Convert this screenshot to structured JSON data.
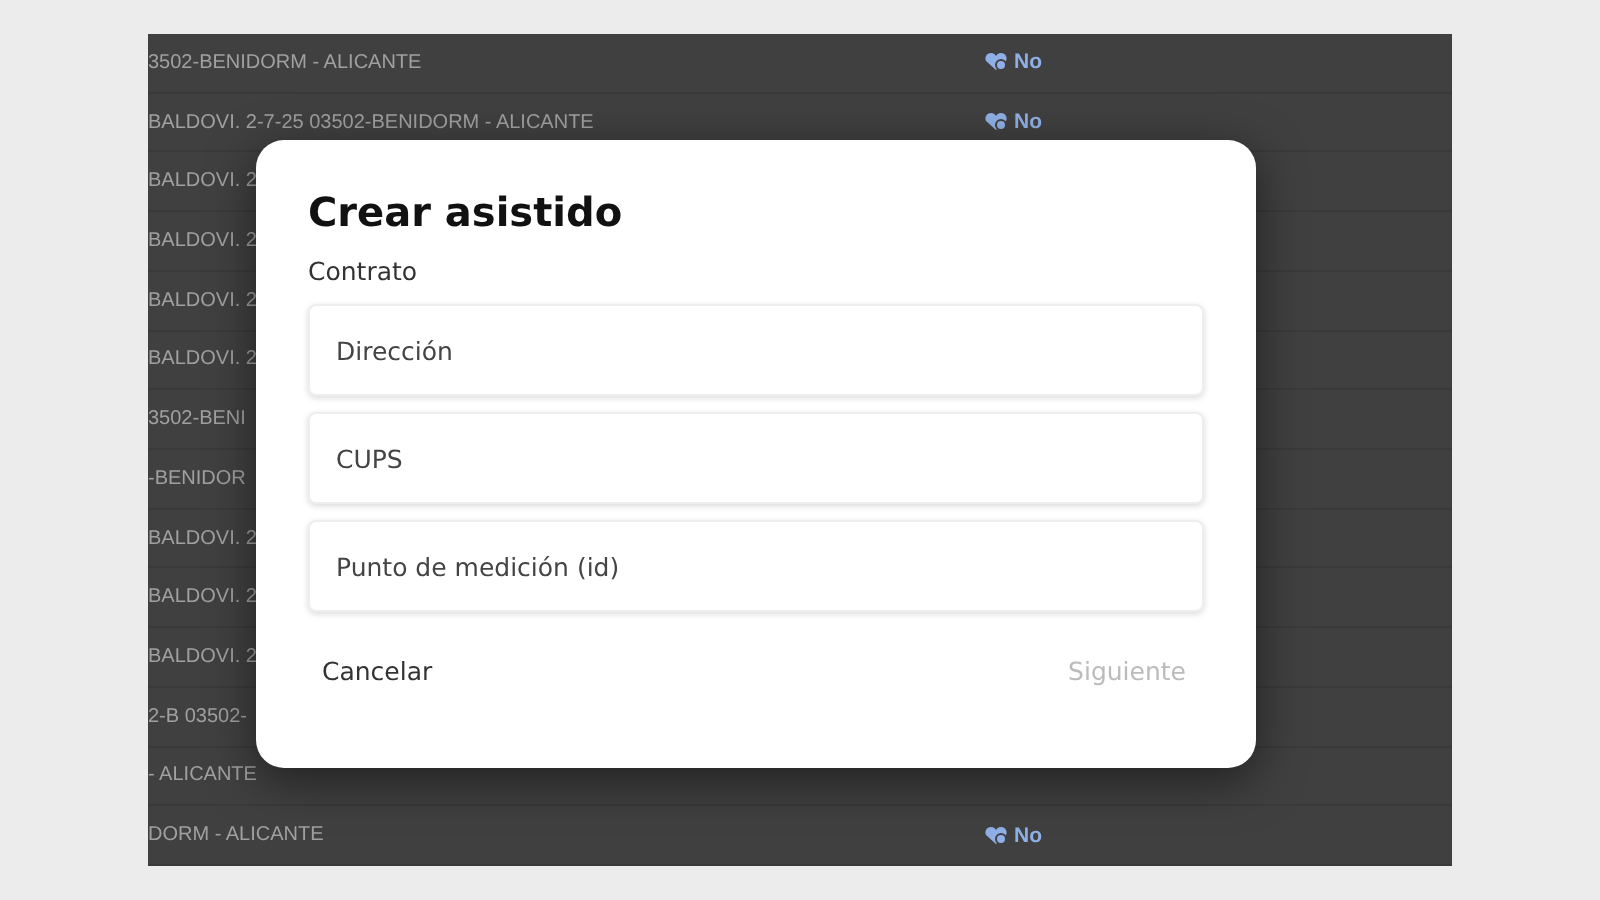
{
  "table": {
    "rows": [
      {
        "column_1": "3502-BENIDORM - ALICANTE",
        "column_2": "No"
      },
      {
        "column_1": "BALDOVI. 2-7-25 03502-BENIDORM - ALICANTE",
        "column_2": "No"
      },
      {
        "column_1": "BALDOVI. 2"
      },
      {
        "column_1": "BALDOVI. 2"
      },
      {
        "column_1": "BALDOVI. 2"
      },
      {
        "column_1": "BALDOVI. 2"
      },
      {
        "column_1": "3502-BENI"
      },
      {
        "column_1": "-BENIDOR"
      },
      {
        "column_1": "BALDOVI. 2"
      },
      {
        "column_1": "BALDOVI. 2"
      },
      {
        "column_1": "BALDOVI. 2"
      },
      {
        "column_1": "2-B 03502-"
      },
      {
        "column_1": "- ALICANTE"
      },
      {
        "column_1": "DORM - ALICANTE",
        "column_2": "No"
      }
    ]
  },
  "dialog": {
    "title": "Crear asistido",
    "section_label": "Contrato",
    "fields": [
      {
        "placeholder": "Dirección"
      },
      {
        "placeholder": "CUPS"
      },
      {
        "placeholder": "Punto de medición (id)"
      }
    ],
    "cancel_button": {
      "label": "Cancelar",
      "disabled": false
    },
    "next_button": {
      "label": "Siguiente",
      "disabled": true
    }
  }
}
